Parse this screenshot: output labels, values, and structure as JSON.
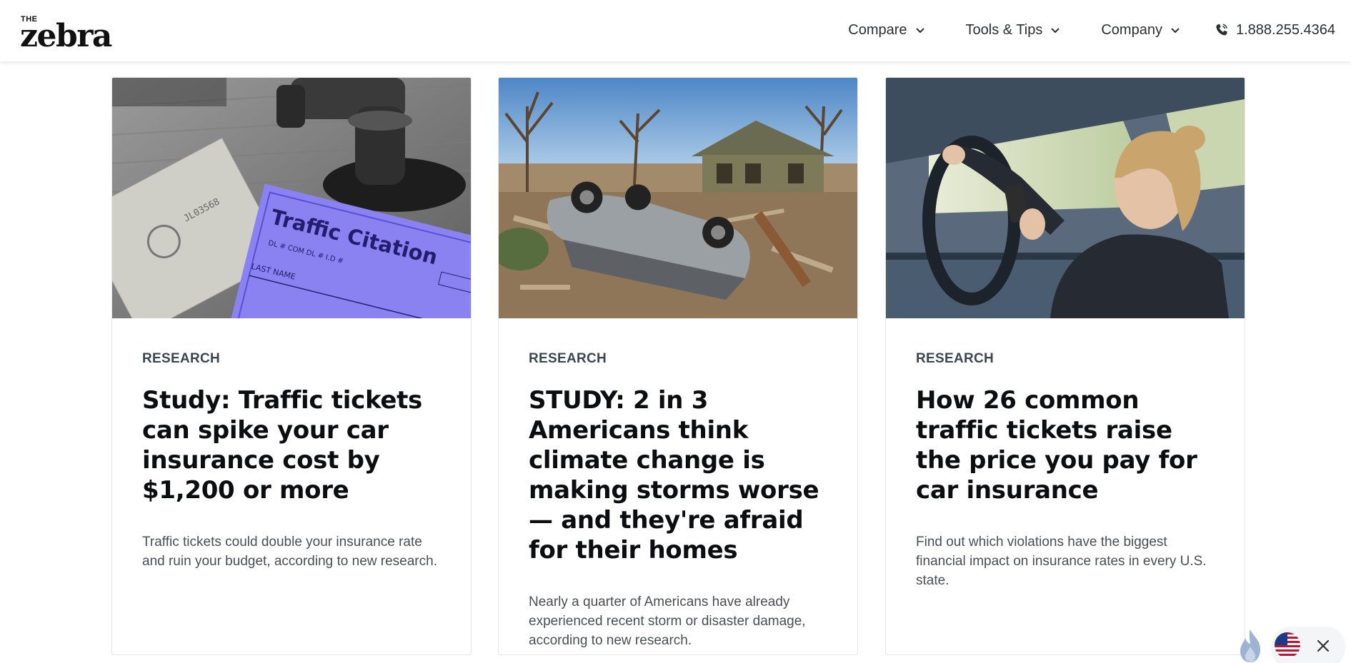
{
  "header": {
    "logo_small": "THE",
    "logo_word": "zebra",
    "nav": [
      {
        "label": "Compare"
      },
      {
        "label": "Tools & Tips"
      },
      {
        "label": "Company"
      }
    ],
    "phone": "1.888.255.4364"
  },
  "cards": [
    {
      "tag": "RESEARCH",
      "title": "Study: Traffic tickets can spike your car insurance cost by $1,200 or more",
      "description": "Traffic tickets could double your insurance rate and ruin your budget, according to new research.",
      "image_text": "Traffic Citation"
    },
    {
      "tag": "RESEARCH",
      "title": "STUDY: 2 in 3 Americans think climate change is making storms worse — and they're afraid for their homes",
      "description": "Nearly a quarter of Americans have already experienced recent storm or disaster damage, according to new research."
    },
    {
      "tag": "RESEARCH",
      "title": "How 26 common traffic tickets raise the price you pay for car insurance",
      "description": "Find out which violations have the biggest financial impact on insurance rates in every U.S. state."
    }
  ],
  "colors": {
    "text_dark": "#0b0d10",
    "tag": "#3c4650",
    "body": "#4a4f55",
    "citation_purple": "#8a82f0"
  }
}
